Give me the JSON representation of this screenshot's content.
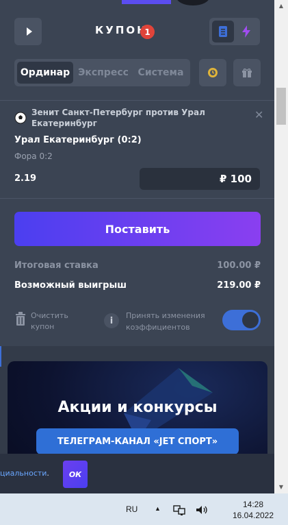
{
  "coupon": {
    "title": "КУПОН",
    "count": "1",
    "icons": {
      "play": "play-icon",
      "list": "list-icon",
      "bolt": "lightning-icon"
    },
    "tabs": [
      {
        "label": "Ординар",
        "active": true
      },
      {
        "label": "Экспресс",
        "active": false
      },
      {
        "label": "Система",
        "active": false
      }
    ],
    "extra_icons": [
      "clock-coin-icon",
      "gift-icon"
    ]
  },
  "bet": {
    "match": "Зенит Санкт-Петербург против Урал Екатеринбург",
    "outcome": "Урал Екатеринбург (0:2)",
    "market": "Фора 0:2",
    "odds": "2.19",
    "stake": "₽ 100"
  },
  "actions": {
    "place_label": "Поставить"
  },
  "summary": {
    "total_label": "Итоговая ставка",
    "total_value": "100.00 ₽",
    "win_label": "Возможный выигрыш",
    "win_value": "219.00 ₽"
  },
  "options": {
    "clear_label_1": "Очистить",
    "clear_label_2": "купон",
    "accept_label_1": "Принять изменения",
    "accept_label_2": "коэффициентов",
    "accept_enabled": true
  },
  "promo": {
    "title": "Акции и конкурсы",
    "button_label": "ТЕЛЕГРАМ-КАНАЛ «JET СПОРТ»"
  },
  "cookie": {
    "text": "циальности",
    "ok_label": "ОК"
  },
  "taskbar": {
    "lang": "RU",
    "time": "14:28",
    "date": "16.04.2022"
  },
  "colors": {
    "accent": "#5b4df0",
    "badge": "#e0443a",
    "toggle": "#3d6fd8",
    "promo_button": "#2f6fd6"
  }
}
